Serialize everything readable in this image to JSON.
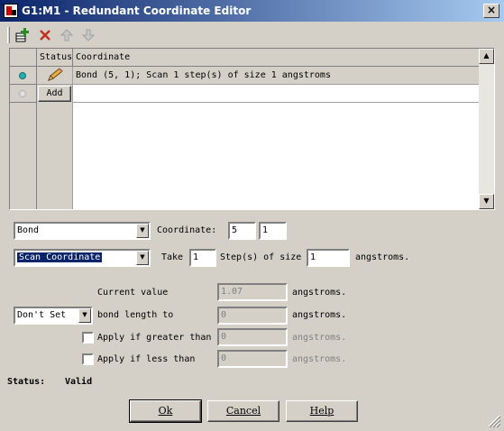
{
  "window": {
    "title": "G1:M1 - Redundant Coordinate Editor",
    "close_glyph": "×"
  },
  "toolbar": {
    "add_icon": "add-row-icon",
    "delete_icon": "delete-x-icon",
    "up_icon": "arrow-up-icon",
    "down_icon": "arrow-down-icon",
    "colors": {
      "add": "#2a8a2a",
      "delete": "#c03020",
      "disabled": "#a0a0a0"
    }
  },
  "grid": {
    "columns": [
      "Status",
      "Coordinate"
    ],
    "rows": [
      {
        "status": "edit",
        "coordinate": "Bond (5, 1); Scan 1 step(s) of size 1 angstroms",
        "dot_color": "#20b0b0"
      }
    ],
    "add_label": "Add",
    "add_dot_color": "#e0e0e0"
  },
  "coord": {
    "type_value": "Bond",
    "coordinate_label": "Coordinate:",
    "atom1": "5",
    "atom2": "1"
  },
  "scan": {
    "action_value": "Scan Coordinate",
    "take_label": "Take",
    "steps": "1",
    "steps_label": "Step(s) of size",
    "size": "1",
    "units": "angstroms."
  },
  "value": {
    "current_label": "Current value",
    "current_value": "1.07",
    "current_units": "angstroms.",
    "set_mode": "Don't Set",
    "bond_length_label": "bond length to",
    "bond_length_value": "0",
    "bond_length_units": "angstroms.",
    "greater_label": "Apply if greater than",
    "greater_value": "0",
    "greater_units": "angstroms.",
    "less_label": "Apply if less than",
    "less_value": "0",
    "less_units": "angstroms."
  },
  "status": {
    "label": "Status:",
    "value": "Valid"
  },
  "buttons": {
    "ok": "Ok",
    "cancel": "Cancel",
    "help": "Help"
  }
}
